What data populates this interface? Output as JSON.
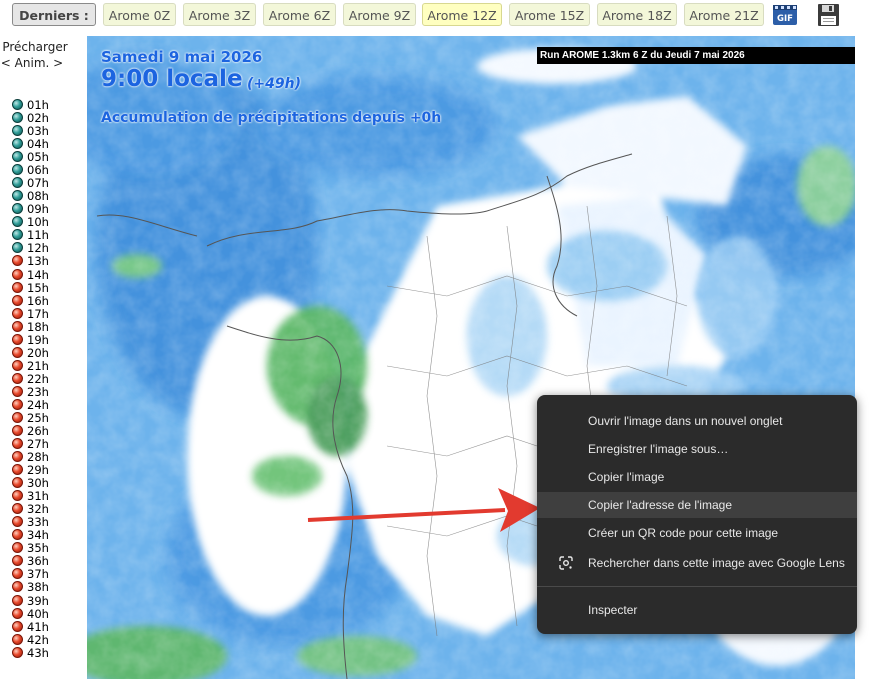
{
  "toolbar": {
    "derniers_label": "Derniers :",
    "runs": [
      "Arome 0Z",
      "Arome 3Z",
      "Arome 6Z",
      "Arome 9Z",
      "Arome 12Z",
      "Arome 15Z",
      "Arome 18Z",
      "Arome 21Z"
    ],
    "active_run": "Arome 12Z",
    "gif_label": "GIF",
    "icons": [
      "gif-film-icon",
      "floppy-disk-icon"
    ]
  },
  "sidebar": {
    "precharger_label": "Précharger",
    "anim_label": "< Anim. >",
    "hours_teal": [
      "01h",
      "02h",
      "03h",
      "04h",
      "05h",
      "06h",
      "07h",
      "08h",
      "09h",
      "10h",
      "11h",
      "12h"
    ],
    "hours_red": [
      "13h",
      "14h",
      "15h",
      "16h",
      "17h",
      "18h",
      "19h",
      "20h",
      "21h",
      "22h",
      "23h",
      "24h",
      "25h",
      "26h",
      "27h",
      "28h",
      "29h",
      "30h",
      "31h",
      "32h",
      "33h",
      "34h",
      "35h",
      "36h",
      "37h",
      "38h",
      "39h",
      "40h",
      "41h",
      "42h",
      "43h"
    ],
    "colors": {
      "teal": "#2f9d98",
      "red": "#e8472a"
    }
  },
  "map": {
    "date": "Samedi 9 mai 2026",
    "time": "9:00 locale",
    "offset": "(+49h)",
    "accumulation": "Accumulation de précipitations depuis +0h",
    "run_info": "Run AROME 1.3km 6 Z du Jeudi 7 mai 2026"
  },
  "context_menu": {
    "items": [
      "Ouvrir l'image dans un nouvel onglet",
      "Enregistrer l'image sous…",
      "Copier l'image",
      "Copier l'adresse de l'image",
      "Créer un QR code pour cette image",
      "Rechercher dans cette image avec Google Lens",
      "Inspecter"
    ],
    "highlighted": "Copier l'adresse de l'image"
  },
  "annotation": {
    "arrow_color": "#e23a2f"
  }
}
